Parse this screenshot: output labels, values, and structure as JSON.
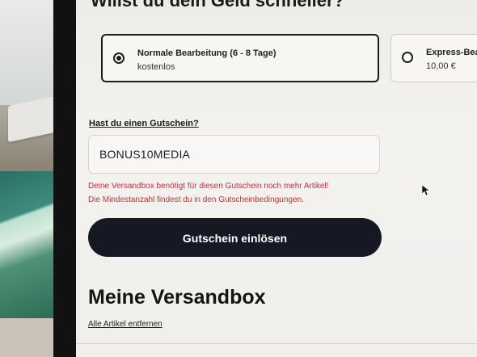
{
  "shipping": {
    "heading": "Willst du dein Geld schneller?",
    "options": [
      {
        "name": "Normale Bearbeitung (6 - 8 Tage)",
        "price": "kostenlos",
        "selected": true
      },
      {
        "name": "Express-Bea",
        "price": "10,00 €",
        "selected": false
      }
    ]
  },
  "coupon": {
    "question": "Hast du einen Gutschein?",
    "value": "BONUS10MEDIA",
    "error_line1": "Deine Versandbox benötigt für diesen Gutschein noch mehr Artikel!",
    "error_line2": "Die Mindestanzahl findest du in den Gutscheinbedingungen.",
    "error_color": "#c0323a",
    "button_label": "Gutschein einlösen",
    "button_color": "#161824"
  },
  "versandbox": {
    "title": "Meine Versandbox",
    "remove_all": "Alle Artikel entfernen"
  },
  "icons": {
    "radio_selected": "radio-checked",
    "radio_unselected": "radio-empty",
    "cursor": "mouse-pointer-icon"
  }
}
